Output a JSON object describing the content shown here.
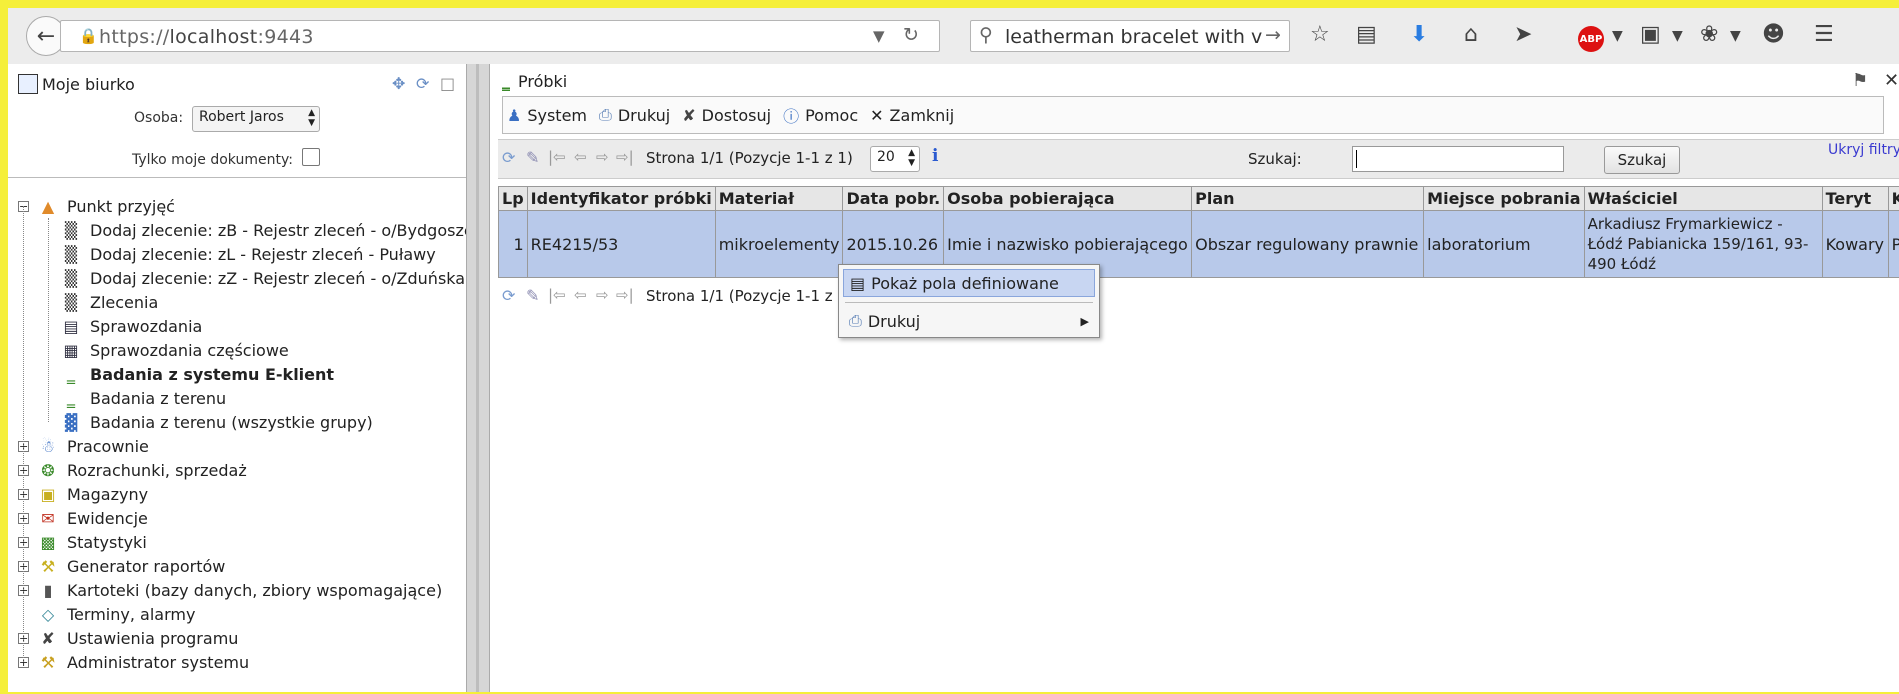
{
  "browser": {
    "url_scheme": "https://",
    "url_host": "localhost",
    "url_port": ":9443",
    "search_value": "leatherman bracelet with v",
    "icons": [
      "back-icon",
      "lock-icon",
      "dropdown-icon",
      "reload-icon",
      "search-icon",
      "forward-arrow-icon",
      "bookmark-star-icon",
      "reading-list-icon",
      "download-icon",
      "home-icon",
      "send-icon",
      "abp-icon",
      "screenshot-icon",
      "extension-icon",
      "emoji-icon",
      "menu-icon"
    ],
    "abp_label": "ABP"
  },
  "left": {
    "title": "Moje biurko",
    "osoba_label": "Osoba:",
    "osoba_value": "Robert Jaros",
    "tylko_label": "Tylko moje dokumenty:",
    "tree": [
      {
        "label": "Punkt przyjęć",
        "bold": false
      },
      {
        "label": "Dodaj zlecenie: zB - Rejestr zleceń - o/Bydgoszcz",
        "bold": false
      },
      {
        "label": "Dodaj zlecenie: zL - Rejestr zleceń - Puławy",
        "bold": false
      },
      {
        "label": "Dodaj zlecenie: zZ - Rejestr zleceń - o/Zduńska Wola",
        "bold": false
      },
      {
        "label": "Zlecenia",
        "bold": false
      },
      {
        "label": "Sprawozdania",
        "bold": false
      },
      {
        "label": "Sprawozdania częściowe",
        "bold": false
      },
      {
        "label": "Badania z systemu E-klient",
        "bold": true
      },
      {
        "label": "Badania z terenu",
        "bold": false
      },
      {
        "label": "Badania z terenu (wszystkie grupy)",
        "bold": false
      },
      {
        "label": "Pracownie",
        "bold": false
      },
      {
        "label": "Rozrachunki, sprzedaż",
        "bold": false
      },
      {
        "label": "Magazyny",
        "bold": false
      },
      {
        "label": "Ewidencje",
        "bold": false
      },
      {
        "label": "Statystyki",
        "bold": false
      },
      {
        "label": "Generator raportów",
        "bold": false
      },
      {
        "label": "Kartoteki (bazy danych, zbiory wspomagające)",
        "bold": false
      },
      {
        "label": "Terminy, alarmy",
        "bold": false
      },
      {
        "label": "Ustawienia programu",
        "bold": false
      },
      {
        "label": "Administrator systemu",
        "bold": false
      }
    ]
  },
  "right": {
    "title": "Próbki",
    "menu": {
      "system": "System",
      "drukuj": "Drukuj",
      "dostosuj": "Dostosuj",
      "pomoc": "Pomoc",
      "zamknij": "Zamknij"
    },
    "pager_text": "Strona 1/1 (Pozycje 1-1 z 1)",
    "page_size": "20",
    "szukaj_label": "Szukaj:",
    "szukaj_value": "",
    "szukaj_button": "Szukaj",
    "ukryj_link": "Ukryj filtry",
    "table": {
      "headers": [
        "Lp",
        "Identyfikator próbki",
        "Materiał",
        "Data pobr.",
        "Osoba pobierająca",
        "Plan",
        "Miejsce pobrania",
        "Właściciel",
        "Teryt",
        "Kraj"
      ],
      "rows": [
        [
          "1",
          "RE4215/53",
          "mikroelementy",
          "2015.10.26",
          "Imie i nazwisko pobierającego",
          "Obszar regulowany prawnie",
          "laboratorium",
          "Arkadiusz Frymarkiewicz - Łódź Pabianicka 159/161, 93-490 Łódź",
          "Kowary",
          "Polska"
        ]
      ]
    },
    "pager_bottom_text": "Strona 1/1 (Pozycje 1-1 z"
  },
  "context_menu": {
    "item1": "Pokaż pola definiowane",
    "item2": "Drukuj"
  },
  "colors": {
    "selected_row": "#b8c9ea",
    "menu_highlight": "#c8d6f2",
    "page_background": "#f5ef3a"
  }
}
